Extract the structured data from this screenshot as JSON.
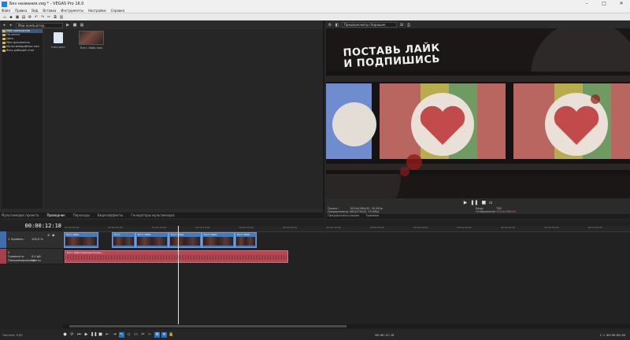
{
  "window": {
    "title": "Без названия.veg * - VEGAS Pro 16.0"
  },
  "menu": [
    "Файл",
    "Правка",
    "Вид",
    "Вставка",
    "Инструменты",
    "Настройки",
    "Справка"
  ],
  "explorer": {
    "path_label": "Мои компьютер, загрузки",
    "tree": [
      {
        "label": "Мой компьютер",
        "selected": true
      },
      {
        "label": "На ленте",
        "selected": false
      },
      {
        "label": "Диск",
        "selected": false
      },
      {
        "label": "Мои документы",
        "selected": false
      },
      {
        "label": "Мультимедийные кни",
        "selected": false
      },
      {
        "label": "Весь рабочий стол",
        "selected": false
      }
    ],
    "files": [
      {
        "name": "intro.mov",
        "kind": "file"
      },
      {
        "name": "Пост-Лайк.mov",
        "kind": "video"
      }
    ],
    "tabs": [
      "Мультимедиа проекта",
      "Проводник",
      "Переходы",
      "Видеоэффекты",
      "Генераторы мультимедиа"
    ]
  },
  "preview": {
    "toolbar_label": "Предпросмотр (Хорошее качество)",
    "overlay_text_line1": "ПОСТАВЬ ЛАЙК",
    "overlay_text_line2": "И ПОДПИШИСЬ",
    "info_project": "Проект:",
    "info_project_val": "1920x1080x32, 59,940p",
    "info_preview": "Предпросмотр:",
    "info_preview_val": "480x270x32, 59,940p",
    "info_frame": "Кадр:",
    "info_frame_val": "736",
    "info_display": "Отображение:",
    "info_display_val": "1920x1080x32",
    "tabs": [
      "Предпросмотр видео",
      "Триммер"
    ]
  },
  "timeline": {
    "timecode": "00:00:12:18",
    "ruler_ticks": [
      "00:00:00;00",
      "00:00:05;00",
      "00:00:10;00",
      "00:00:15;00",
      "00:00:20;00",
      "00:00:25;00",
      "00:00:30;00",
      "00:00:35;00",
      "00:00:40;00",
      "00:00:45;00",
      "00:00:50;00",
      "00:00:55;00",
      "00:01:00;00"
    ],
    "video_track": {
      "num": "1",
      "label": "Уровень:",
      "value": "100,0 %"
    },
    "audio_track": {
      "num": "2",
      "vol_label": "Громкость:",
      "vol_value": "0,0 дБ",
      "pan_label": "Панорамирование:",
      "pan_value": "Центр"
    },
    "clip_names": [
      "Пост-Лайк",
      "Пост",
      "Пост-Лайк",
      "Пост-Лайк",
      "Пост-Лайк",
      "Пост-Лайк"
    ],
    "audio_clip_name": "Пост-Лайк-Подпиши-Конец-..."
  },
  "transport": {
    "rate": "Частота: 0,00",
    "time": "00:00:12;18",
    "end": "1:1 00:00:00;00"
  },
  "colors": {
    "video_clip": "#4a79b8",
    "audio_clip": "#b24a55",
    "accent": "#2f6fb3"
  }
}
